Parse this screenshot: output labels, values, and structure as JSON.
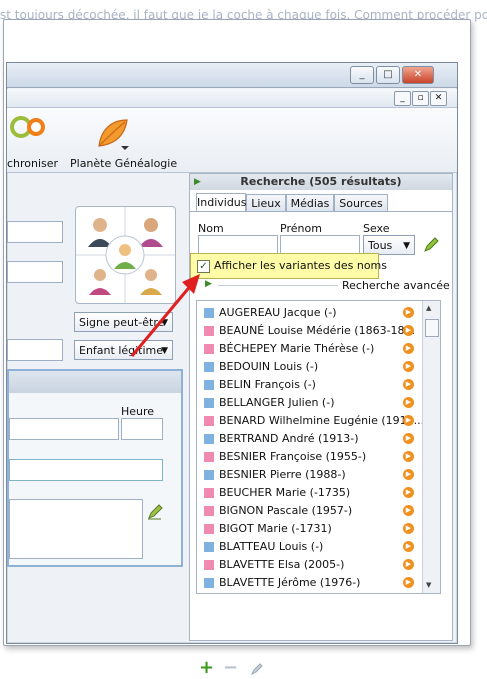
{
  "background_text": "st toujours décochée, il faut que je la coche à chaque fois. Comment procéder pour",
  "window": {
    "minimize": "_",
    "maximize": "□",
    "close": "✕",
    "mdi_min": "_",
    "mdi_restore": "▫",
    "mdi_close": "✕"
  },
  "ribbon": {
    "sync_label": "chroniser",
    "planete_label": "Planète Généalogie"
  },
  "left": {
    "signe_label": "Signe peut-être",
    "enfant_label": "Enfant légitime",
    "heure_label": "Heure"
  },
  "search": {
    "header": "Recherche (505 résultats)",
    "tabs": [
      "Individus",
      "Lieux",
      "Médias",
      "Sources"
    ],
    "nom_label": "Nom",
    "prenom_label": "Prénom",
    "sexe_label": "Sexe",
    "sexe_value": "Tous",
    "advanced_label": "Recherche avancée",
    "variants_label": "Afficher les variantes des noms"
  },
  "results": [
    {
      "name": "AUGEREAU Jacque (-)",
      "sex": "m"
    },
    {
      "name": "BEAUNÉ Louise Médérie (1863-18...",
      "sex": "f"
    },
    {
      "name": "BÉCHEPEY Marie Thérèse (-)",
      "sex": "f"
    },
    {
      "name": "BEDOUIN Louis (-)",
      "sex": "m"
    },
    {
      "name": "BELIN François (-)",
      "sex": "m"
    },
    {
      "name": "BELLANGER Julien (-)",
      "sex": "m"
    },
    {
      "name": "BENARD Wilhelmine Eugénie (1914...",
      "sex": "f"
    },
    {
      "name": "BERTRAND André (1913-)",
      "sex": "m"
    },
    {
      "name": "BESNIER Françoise (1955-)",
      "sex": "f"
    },
    {
      "name": "BESNIER Pierre (1988-)",
      "sex": "m"
    },
    {
      "name": "BEUCHER Marie (-1735)",
      "sex": "f"
    },
    {
      "name": "BIGNON Pascale (1957-)",
      "sex": "f"
    },
    {
      "name": "BIGOT Marie (-1731)",
      "sex": "f"
    },
    {
      "name": "BLATTEAU Louis (-)",
      "sex": "m"
    },
    {
      "name": "BLAVETTE Elsa (2005-)",
      "sex": "f"
    },
    {
      "name": "BLAVETTE Jérôme (1976-)",
      "sex": "m"
    }
  ],
  "colors": {
    "male": "#7fb2e0",
    "female": "#f08ab0",
    "accent": "#f0901e",
    "arrow": "#e02020"
  }
}
